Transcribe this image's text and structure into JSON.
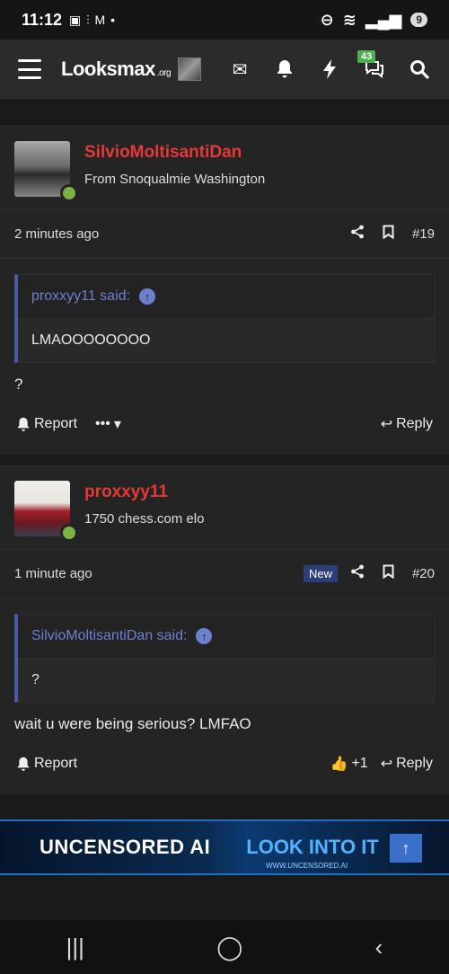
{
  "status_bar": {
    "time": "11:12",
    "icons": "▣ ⫶ M •",
    "battery": "9"
  },
  "nav": {
    "logo_main": "Looksmax",
    "logo_sub": ".org",
    "alerts_badge": "43"
  },
  "posts": [
    {
      "username": "SilvioMoltisantiDan",
      "user_title": "From Snoqualmie Washington",
      "time": "2 minutes ago",
      "number": "#19",
      "quote_author": "proxxyy11 said:",
      "quote_body": "LMAOOOOOOOO",
      "body": "?",
      "report_label": "Report",
      "more_label": "•••",
      "reply_label": "Reply"
    },
    {
      "username": "proxxyy11",
      "user_title": "1750 chess.com elo",
      "time": "1 minute ago",
      "new_badge": "New",
      "number": "#20",
      "quote_author": "SilvioMoltisantiDan said:",
      "quote_body": "?",
      "body": "wait u were being serious? LMFAO",
      "report_label": "Report",
      "like_label": "+1",
      "reply_label": "Reply"
    }
  ],
  "ad": {
    "text1": "UNCENSORED AI",
    "text2": "LOOK INTO IT",
    "url": "WWW.UNCENSORED.AI"
  },
  "colors": {
    "accent_username": "#e53935",
    "online": "#7cb342",
    "quote_bar": "#4a5aa8"
  }
}
